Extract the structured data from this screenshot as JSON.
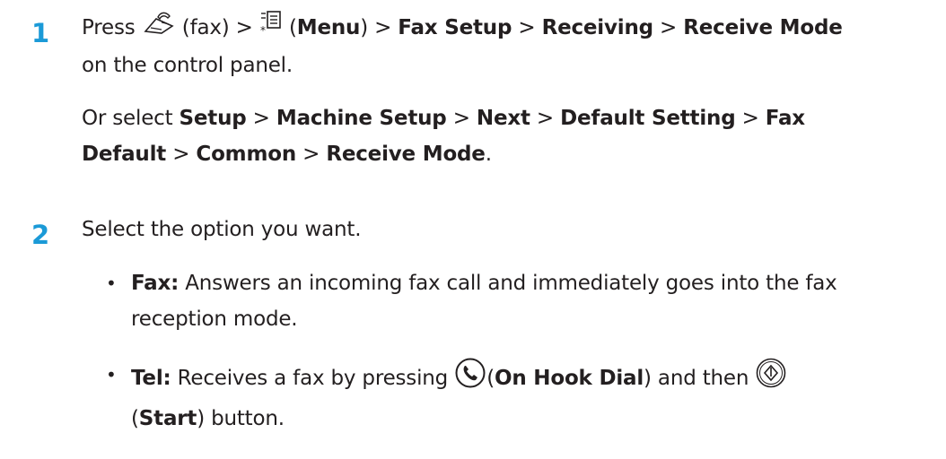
{
  "step1": {
    "number": "1",
    "press": "Press",
    "fax_text": "(fax) >",
    "menu_open": "(",
    "menu": "Menu",
    "menu_close": ") >",
    "fax_setup": "Fax Setup",
    "gt1": ">",
    "receiving": "Receiving",
    "gt2": ">",
    "receive_mode": "Receive Mode",
    "line2": "on the control panel.",
    "alt_or": "Or select",
    "alt_setup": "Setup",
    "alt_gt1": ">",
    "alt_machine_setup": "Machine Setup",
    "alt_gt2": ">",
    "alt_next": "Next",
    "alt_gt3": ">",
    "alt_default_setting": "Default Setting",
    "alt_gt4": ">",
    "alt_fax": "Fax",
    "alt_default": "Default",
    "alt_gt5": ">",
    "alt_common": "Common",
    "alt_gt6": ">",
    "alt_receive_mode": "Receive Mode",
    "alt_period": "."
  },
  "step2": {
    "number": "2",
    "intro": "Select the option you want.",
    "bullet_symbol": "•",
    "fax_label": "Fax:",
    "fax_desc_line1": "Answers an incoming fax call and immediately goes into the fax",
    "fax_desc_line2": "reception mode.",
    "tel_label": "Tel:",
    "tel_desc_a": "Receives a fax by pressing",
    "tel_open": "(",
    "on_hook_dial": "On Hook Dial",
    "tel_desc_b": ") and then",
    "start_open": "(",
    "start": "Start",
    "start_close": ") button."
  },
  "icons": {
    "fax": "fax-icon",
    "menu": "menu-icon",
    "on_hook_dial": "on-hook-dial-icon",
    "start": "start-icon",
    "accent_color": "#1b9ad7"
  }
}
